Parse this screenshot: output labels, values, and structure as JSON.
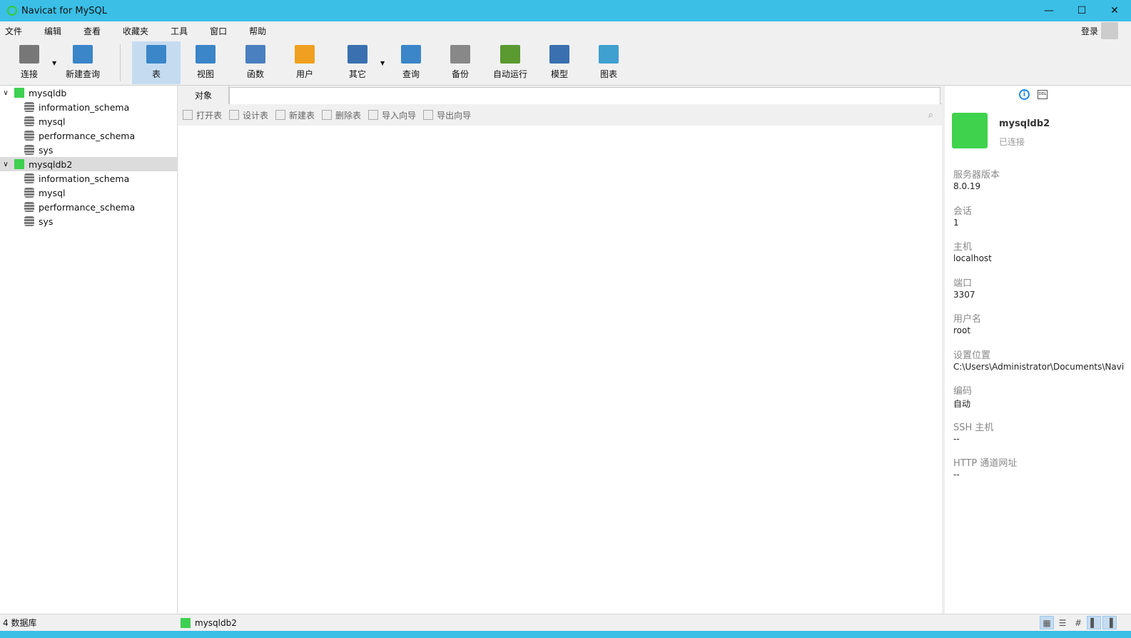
{
  "window": {
    "title": "Navicat for MySQL",
    "minimize": "—",
    "maximize": "☐",
    "close": "✕"
  },
  "menu": [
    "文件",
    "编辑",
    "查看",
    "收藏夹",
    "工具",
    "窗口",
    "帮助"
  ],
  "login": "登录",
  "toolbar": [
    {
      "label": "连接",
      "color": "#777"
    },
    {
      "label": "新建查询",
      "color": "#3a86c8"
    },
    {
      "label": "表",
      "color": "#3a86c8"
    },
    {
      "label": "视图",
      "color": "#3a86c8"
    },
    {
      "label": "函数",
      "color": "#4a7fc0"
    },
    {
      "label": "用户",
      "color": "#f0a020"
    },
    {
      "label": "其它",
      "color": "#3a70b0"
    },
    {
      "label": "查询",
      "color": "#3a86c8"
    },
    {
      "label": "备份",
      "color": "#888"
    },
    {
      "label": "自动运行",
      "color": "#5a9a30"
    },
    {
      "label": "模型",
      "color": "#3a70b0"
    },
    {
      "label": "图表",
      "color": "#40a0d0"
    }
  ],
  "tree": [
    {
      "name": "mysqldb",
      "children": [
        "information_schema",
        "mysql",
        "performance_schema",
        "sys"
      ]
    },
    {
      "name": "mysqldb2",
      "children": [
        "information_schema",
        "mysql",
        "performance_schema",
        "sys"
      ]
    }
  ],
  "tabs": {
    "objects": "对象"
  },
  "object_toolbar": [
    "打开表",
    "设计表",
    "新建表",
    "删除表",
    "导入向导",
    "导出向导"
  ],
  "search_icon": "⌕",
  "info_panel": {
    "info_icon": "i",
    "ddl_icon": "DDL",
    "name": "mysqldb2",
    "status": "已连接",
    "properties": [
      {
        "key": "服务器版本",
        "value": "8.0.19"
      },
      {
        "key": "会话",
        "value": "1"
      },
      {
        "key": "主机",
        "value": "localhost"
      },
      {
        "key": "端口",
        "value": "3307"
      },
      {
        "key": "用户名",
        "value": "root"
      },
      {
        "key": "设置位置",
        "value": "C:\\Users\\Administrator\\Documents\\Navicat"
      },
      {
        "key": "编码",
        "value": "自动"
      },
      {
        "key": "SSH 主机",
        "value": "--"
      },
      {
        "key": "HTTP 通道网址",
        "value": "--"
      }
    ]
  },
  "statusbar": {
    "count": "4 数据库",
    "connection": "mysqldb2"
  }
}
